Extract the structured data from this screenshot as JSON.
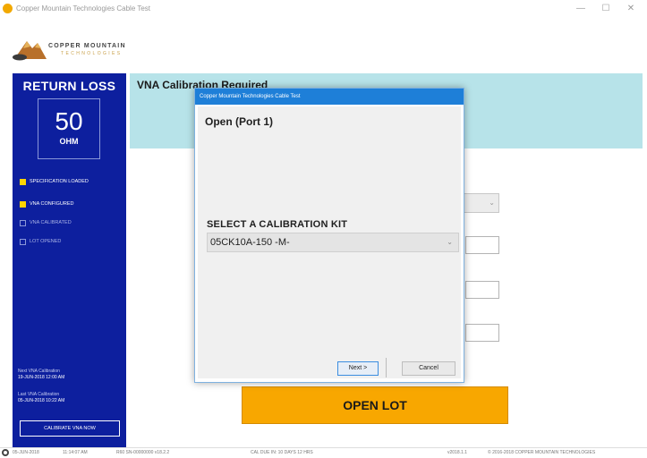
{
  "window": {
    "title": "Copper Mountain Technologies Cable Test",
    "controls": [
      "—",
      "☐",
      "✕"
    ]
  },
  "logo": {
    "name": "COPPER MOUNTAIN",
    "sub": "TECHNOLOGIES"
  },
  "sidebar": {
    "title": "RETURN LOSS",
    "metric_value": "50",
    "metric_unit": "OHM",
    "status_items": [
      {
        "label": "SPECIFICATION LOADED",
        "checked": true
      },
      {
        "label": "VNA CONFIGURED",
        "checked": true
      },
      {
        "label": "VNA CALIBRATED",
        "checked": false
      },
      {
        "label": "LOT OPENED",
        "checked": false
      }
    ],
    "next_cal_label": "Next VNA Calibration",
    "next_cal_value": "19-JUN-2018 12:00 AM",
    "last_cal_label": "Last VNA Calibration",
    "last_cal_value": "05-JUN-2018 10:22 AM",
    "calibrate_button": "CALIBRATE VNA NOW"
  },
  "main": {
    "banner_title": "VNA Calibration Required",
    "open_lot_button": "OPEN LOT"
  },
  "dialog": {
    "title": "Copper Mountain Technologies Cable Test",
    "heading": "Open (Port 1)",
    "kit_label": "SELECT A CALIBRATION KIT",
    "kit_value": "05CK10A-150 -M-",
    "next_button": "Next >",
    "cancel_button": "Cancel"
  },
  "statusbar": {
    "date": "05-JUN-2018",
    "time": "11:14:07 AM",
    "device": "R60  SN-00000000  v18.2.2",
    "cal_due": "CAL DUE IN: 10 DAYS 12 HRS",
    "version": "v2018.1.1",
    "copyright": "© 2016-2018 COPPER MOUNTAIN TECHNOLOGIES"
  },
  "colors": {
    "sidebar": "#0d1f9e",
    "banner": "#b7e3e9",
    "accent": "#f8a700",
    "checked": "#ffd400",
    "dialog_title": "#1e7fd8"
  }
}
